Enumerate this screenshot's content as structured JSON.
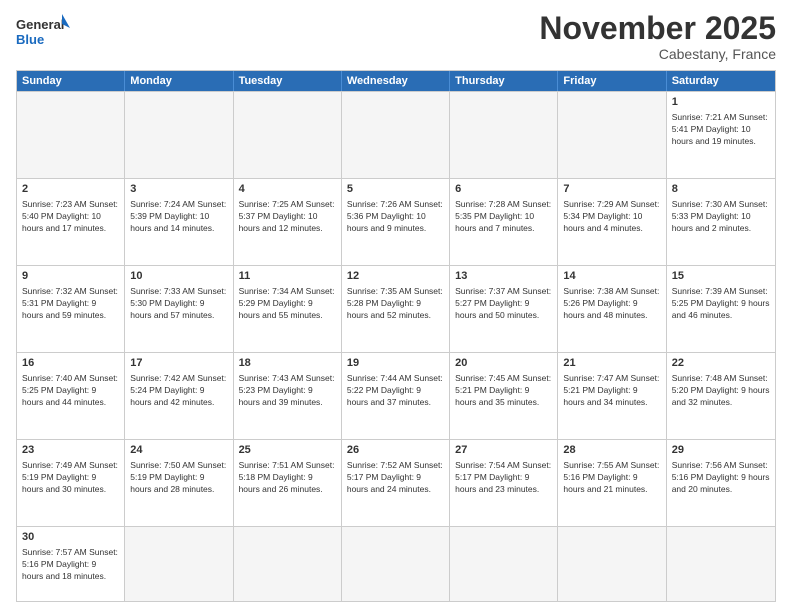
{
  "logo": {
    "general": "General",
    "blue": "Blue"
  },
  "title": "November 2025",
  "location": "Cabestany, France",
  "header_days": [
    "Sunday",
    "Monday",
    "Tuesday",
    "Wednesday",
    "Thursday",
    "Friday",
    "Saturday"
  ],
  "weeks": [
    [
      {
        "day": "",
        "info": ""
      },
      {
        "day": "",
        "info": ""
      },
      {
        "day": "",
        "info": ""
      },
      {
        "day": "",
        "info": ""
      },
      {
        "day": "",
        "info": ""
      },
      {
        "day": "",
        "info": ""
      },
      {
        "day": "1",
        "info": "Sunrise: 7:21 AM\nSunset: 5:41 PM\nDaylight: 10 hours\nand 19 minutes."
      }
    ],
    [
      {
        "day": "2",
        "info": "Sunrise: 7:23 AM\nSunset: 5:40 PM\nDaylight: 10 hours\nand 17 minutes."
      },
      {
        "day": "3",
        "info": "Sunrise: 7:24 AM\nSunset: 5:39 PM\nDaylight: 10 hours\nand 14 minutes."
      },
      {
        "day": "4",
        "info": "Sunrise: 7:25 AM\nSunset: 5:37 PM\nDaylight: 10 hours\nand 12 minutes."
      },
      {
        "day": "5",
        "info": "Sunrise: 7:26 AM\nSunset: 5:36 PM\nDaylight: 10 hours\nand 9 minutes."
      },
      {
        "day": "6",
        "info": "Sunrise: 7:28 AM\nSunset: 5:35 PM\nDaylight: 10 hours\nand 7 minutes."
      },
      {
        "day": "7",
        "info": "Sunrise: 7:29 AM\nSunset: 5:34 PM\nDaylight: 10 hours\nand 4 minutes."
      },
      {
        "day": "8",
        "info": "Sunrise: 7:30 AM\nSunset: 5:33 PM\nDaylight: 10 hours\nand 2 minutes."
      }
    ],
    [
      {
        "day": "9",
        "info": "Sunrise: 7:32 AM\nSunset: 5:31 PM\nDaylight: 9 hours\nand 59 minutes."
      },
      {
        "day": "10",
        "info": "Sunrise: 7:33 AM\nSunset: 5:30 PM\nDaylight: 9 hours\nand 57 minutes."
      },
      {
        "day": "11",
        "info": "Sunrise: 7:34 AM\nSunset: 5:29 PM\nDaylight: 9 hours\nand 55 minutes."
      },
      {
        "day": "12",
        "info": "Sunrise: 7:35 AM\nSunset: 5:28 PM\nDaylight: 9 hours\nand 52 minutes."
      },
      {
        "day": "13",
        "info": "Sunrise: 7:37 AM\nSunset: 5:27 PM\nDaylight: 9 hours\nand 50 minutes."
      },
      {
        "day": "14",
        "info": "Sunrise: 7:38 AM\nSunset: 5:26 PM\nDaylight: 9 hours\nand 48 minutes."
      },
      {
        "day": "15",
        "info": "Sunrise: 7:39 AM\nSunset: 5:25 PM\nDaylight: 9 hours\nand 46 minutes."
      }
    ],
    [
      {
        "day": "16",
        "info": "Sunrise: 7:40 AM\nSunset: 5:25 PM\nDaylight: 9 hours\nand 44 minutes."
      },
      {
        "day": "17",
        "info": "Sunrise: 7:42 AM\nSunset: 5:24 PM\nDaylight: 9 hours\nand 42 minutes."
      },
      {
        "day": "18",
        "info": "Sunrise: 7:43 AM\nSunset: 5:23 PM\nDaylight: 9 hours\nand 39 minutes."
      },
      {
        "day": "19",
        "info": "Sunrise: 7:44 AM\nSunset: 5:22 PM\nDaylight: 9 hours\nand 37 minutes."
      },
      {
        "day": "20",
        "info": "Sunrise: 7:45 AM\nSunset: 5:21 PM\nDaylight: 9 hours\nand 35 minutes."
      },
      {
        "day": "21",
        "info": "Sunrise: 7:47 AM\nSunset: 5:21 PM\nDaylight: 9 hours\nand 34 minutes."
      },
      {
        "day": "22",
        "info": "Sunrise: 7:48 AM\nSunset: 5:20 PM\nDaylight: 9 hours\nand 32 minutes."
      }
    ],
    [
      {
        "day": "23",
        "info": "Sunrise: 7:49 AM\nSunset: 5:19 PM\nDaylight: 9 hours\nand 30 minutes."
      },
      {
        "day": "24",
        "info": "Sunrise: 7:50 AM\nSunset: 5:19 PM\nDaylight: 9 hours\nand 28 minutes."
      },
      {
        "day": "25",
        "info": "Sunrise: 7:51 AM\nSunset: 5:18 PM\nDaylight: 9 hours\nand 26 minutes."
      },
      {
        "day": "26",
        "info": "Sunrise: 7:52 AM\nSunset: 5:17 PM\nDaylight: 9 hours\nand 24 minutes."
      },
      {
        "day": "27",
        "info": "Sunrise: 7:54 AM\nSunset: 5:17 PM\nDaylight: 9 hours\nand 23 minutes."
      },
      {
        "day": "28",
        "info": "Sunrise: 7:55 AM\nSunset: 5:16 PM\nDaylight: 9 hours\nand 21 minutes."
      },
      {
        "day": "29",
        "info": "Sunrise: 7:56 AM\nSunset: 5:16 PM\nDaylight: 9 hours\nand 20 minutes."
      }
    ],
    [
      {
        "day": "30",
        "info": "Sunrise: 7:57 AM\nSunset: 5:16 PM\nDaylight: 9 hours\nand 18 minutes."
      },
      {
        "day": "",
        "info": ""
      },
      {
        "day": "",
        "info": ""
      },
      {
        "day": "",
        "info": ""
      },
      {
        "day": "",
        "info": ""
      },
      {
        "day": "",
        "info": ""
      },
      {
        "day": "",
        "info": ""
      }
    ]
  ]
}
